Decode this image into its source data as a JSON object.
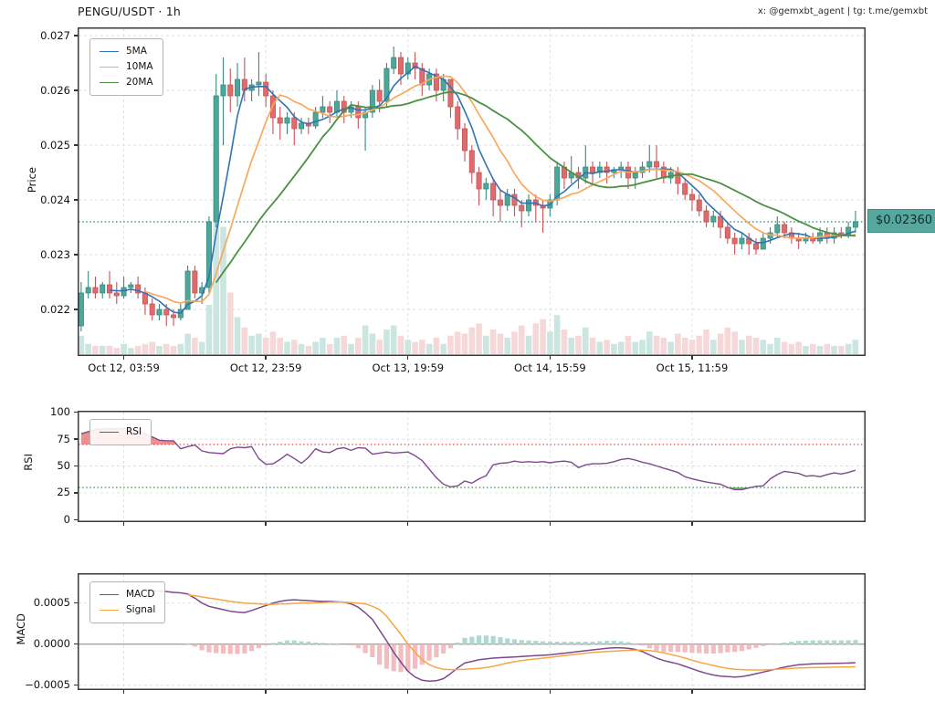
{
  "header": {
    "title": "PENGU/USDT · 1h",
    "watermark": "x: @gemxbt_agent | tg: t.me/gemxbt"
  },
  "price_panel": {
    "ylabel": "Price",
    "y_ticks": [
      "0.027",
      "0.026",
      "0.025",
      "0.024",
      "0.023",
      "0.022"
    ],
    "x_ticks": [
      "Oct 12, 03:59",
      "Oct 12, 23:59",
      "Oct 13, 19:59",
      "Oct 14, 15:59",
      "Oct 15, 11:59"
    ],
    "legend": [
      "5MA",
      "10MA",
      "20MA"
    ],
    "price_tag": "$0.02360"
  },
  "rsi_panel": {
    "ylabel": "RSI",
    "legend": [
      "RSI"
    ],
    "y_ticks": [
      "100",
      "75",
      "50",
      "25",
      "0"
    ],
    "overbought": 70,
    "oversold": 30
  },
  "macd_panel": {
    "ylabel": "MACD",
    "legend": [
      "MACD",
      "Signal"
    ],
    "y_ticks": [
      "0.0005",
      "0.0000",
      "−0.0005"
    ]
  },
  "colors": {
    "up": "#4aa79a",
    "up_border": "#3a8a7e",
    "down": "#e06b6d",
    "down_border": "#c65356",
    "vol_up": "#cbe6e1",
    "vol_down": "#f7d8d9",
    "ma5": "#3173b5",
    "ma10": "#f9a85f",
    "ma20": "#4a9141",
    "rsi": "#7e4a8e",
    "overbought_line": "#ef5a5a",
    "oversold_line": "#43a047",
    "overbought_fill": "rgba(232,74,74,0.62)",
    "oversold_fill": "rgba(67,160,71,0.72)",
    "macd": "#7e4a8e",
    "signal": "#f5a742",
    "hist_up": "#aed9d2",
    "hist_down": "#f3bdc0",
    "price_line": "#43968c",
    "price_tag_bg": "#56a89e",
    "grid": "#dcdcdc",
    "spine": "#3a3a3a"
  },
  "chart_data": {
    "type": "candlestick",
    "title": "PENGU/USDT · 1h",
    "last_price": 0.0236,
    "price_ylim": [
      0.02115,
      0.02715
    ],
    "volume_max": 100,
    "tick_indices": [
      6,
      26,
      46,
      66,
      86
    ],
    "tick_labels": [
      "Oct 12, 03:59",
      "Oct 12, 23:59",
      "Oct 13, 19:59",
      "Oct 14, 15:59",
      "Oct 15, 11:59"
    ],
    "ma_windows": [
      5,
      10,
      20
    ],
    "candles_format": [
      "open",
      "high",
      "low",
      "close",
      "volume"
    ],
    "candles": [
      [
        0.0217,
        0.0225,
        0.0216,
        0.0223,
        9
      ],
      [
        0.0223,
        0.0227,
        0.0222,
        0.0224,
        5
      ],
      [
        0.0224,
        0.0226,
        0.0222,
        0.0223,
        4
      ],
      [
        0.0223,
        0.0225,
        0.0222,
        0.02245,
        4
      ],
      [
        0.02245,
        0.0227,
        0.0222,
        0.0223,
        4
      ],
      [
        0.0223,
        0.0225,
        0.0221,
        0.02225,
        3
      ],
      [
        0.02225,
        0.0226,
        0.0222,
        0.0224,
        5
      ],
      [
        0.0224,
        0.0225,
        0.0223,
        0.02245,
        3
      ],
      [
        0.02245,
        0.0226,
        0.0222,
        0.0223,
        4
      ],
      [
        0.0223,
        0.0224,
        0.0219,
        0.0221,
        5
      ],
      [
        0.0221,
        0.0222,
        0.0218,
        0.0219,
        6
      ],
      [
        0.0219,
        0.0221,
        0.0218,
        0.022,
        4
      ],
      [
        0.022,
        0.0221,
        0.0217,
        0.0219,
        5
      ],
      [
        0.0219,
        0.022,
        0.0217,
        0.02185,
        4
      ],
      [
        0.02185,
        0.0221,
        0.0218,
        0.022,
        5
      ],
      [
        0.022,
        0.0228,
        0.022,
        0.0227,
        10
      ],
      [
        0.0227,
        0.0228,
        0.0222,
        0.0223,
        8
      ],
      [
        0.0223,
        0.0225,
        0.0221,
        0.0224,
        6
      ],
      [
        0.0224,
        0.0237,
        0.0223,
        0.0236,
        24
      ],
      [
        0.0236,
        0.0263,
        0.0235,
        0.0259,
        100
      ],
      [
        0.0259,
        0.0266,
        0.025,
        0.0261,
        62
      ],
      [
        0.0261,
        0.0264,
        0.0256,
        0.0259,
        30
      ],
      [
        0.0259,
        0.0265,
        0.0257,
        0.0262,
        18
      ],
      [
        0.0262,
        0.0266,
        0.0258,
        0.026,
        13
      ],
      [
        0.026,
        0.0262,
        0.0258,
        0.0261,
        9
      ],
      [
        0.0261,
        0.0267,
        0.0259,
        0.02615,
        10
      ],
      [
        0.02615,
        0.0263,
        0.0257,
        0.0259,
        8
      ],
      [
        0.0259,
        0.026,
        0.0252,
        0.0255,
        11
      ],
      [
        0.0255,
        0.0257,
        0.0251,
        0.0254,
        8
      ],
      [
        0.0254,
        0.0256,
        0.0252,
        0.0255,
        6
      ],
      [
        0.0255,
        0.0256,
        0.025,
        0.0253,
        7
      ],
      [
        0.0253,
        0.0255,
        0.0252,
        0.0254,
        5
      ],
      [
        0.0254,
        0.0255,
        0.0252,
        0.02535,
        4
      ],
      [
        0.02535,
        0.0257,
        0.0253,
        0.0256,
        6
      ],
      [
        0.0256,
        0.0259,
        0.0255,
        0.0257,
        8
      ],
      [
        0.0257,
        0.0258,
        0.0254,
        0.0256,
        5
      ],
      [
        0.0256,
        0.026,
        0.0255,
        0.0258,
        8
      ],
      [
        0.0258,
        0.0259,
        0.0254,
        0.0256,
        9
      ],
      [
        0.0256,
        0.0258,
        0.0255,
        0.0257,
        5
      ],
      [
        0.0257,
        0.0258,
        0.0253,
        0.0255,
        8
      ],
      [
        0.0255,
        0.0257,
        0.0249,
        0.0256,
        14
      ],
      [
        0.0256,
        0.0261,
        0.0255,
        0.026,
        10
      ],
      [
        0.026,
        0.0262,
        0.0256,
        0.0258,
        7
      ],
      [
        0.0258,
        0.0265,
        0.0257,
        0.0264,
        12
      ],
      [
        0.0264,
        0.0268,
        0.0263,
        0.0266,
        14
      ],
      [
        0.0266,
        0.0267,
        0.0261,
        0.0263,
        9
      ],
      [
        0.0263,
        0.0266,
        0.0262,
        0.0265,
        7
      ],
      [
        0.0265,
        0.0267,
        0.0262,
        0.0264,
        6
      ],
      [
        0.0264,
        0.0265,
        0.0259,
        0.0261,
        7
      ],
      [
        0.0261,
        0.0264,
        0.026,
        0.0263,
        5
      ],
      [
        0.0263,
        0.0264,
        0.0258,
        0.026,
        8
      ],
      [
        0.026,
        0.0263,
        0.0258,
        0.0262,
        5
      ],
      [
        0.0262,
        0.0262,
        0.0255,
        0.0257,
        9
      ],
      [
        0.0257,
        0.0258,
        0.0251,
        0.0253,
        11
      ],
      [
        0.0253,
        0.0254,
        0.0247,
        0.0249,
        10
      ],
      [
        0.0249,
        0.025,
        0.0243,
        0.0245,
        13
      ],
      [
        0.0245,
        0.0246,
        0.0239,
        0.0242,
        15
      ],
      [
        0.0242,
        0.0244,
        0.024,
        0.0243,
        9
      ],
      [
        0.0243,
        0.0244,
        0.0237,
        0.024,
        12
      ],
      [
        0.024,
        0.0242,
        0.0236,
        0.0239,
        10
      ],
      [
        0.0239,
        0.0242,
        0.0238,
        0.0241,
        8
      ],
      [
        0.0241,
        0.0242,
        0.0237,
        0.0239,
        11
      ],
      [
        0.0239,
        0.024,
        0.0235,
        0.0238,
        14
      ],
      [
        0.0238,
        0.0241,
        0.0237,
        0.024,
        9
      ],
      [
        0.024,
        0.0241,
        0.0236,
        0.0239,
        15
      ],
      [
        0.0239,
        0.024,
        0.0234,
        0.02385,
        17
      ],
      [
        0.02385,
        0.0241,
        0.0237,
        0.024,
        11
      ],
      [
        0.024,
        0.0247,
        0.0239,
        0.0246,
        19
      ],
      [
        0.0246,
        0.0247,
        0.0242,
        0.0244,
        12
      ],
      [
        0.0244,
        0.0248,
        0.0243,
        0.0245,
        8
      ],
      [
        0.0245,
        0.0246,
        0.0242,
        0.0244,
        9
      ],
      [
        0.0244,
        0.025,
        0.0243,
        0.0246,
        13
      ],
      [
        0.0246,
        0.0247,
        0.0243,
        0.0245,
        8
      ],
      [
        0.0245,
        0.0247,
        0.0244,
        0.0246,
        6
      ],
      [
        0.0246,
        0.0247,
        0.0243,
        0.0245,
        7
      ],
      [
        0.0245,
        0.0246,
        0.0244,
        0.02455,
        5
      ],
      [
        0.02455,
        0.0247,
        0.0244,
        0.0246,
        6
      ],
      [
        0.0246,
        0.0247,
        0.0242,
        0.0244,
        9
      ],
      [
        0.0244,
        0.0246,
        0.0242,
        0.0245,
        6
      ],
      [
        0.0245,
        0.0247,
        0.0244,
        0.0246,
        7
      ],
      [
        0.0246,
        0.025,
        0.0245,
        0.0247,
        11
      ],
      [
        0.0247,
        0.025,
        0.0244,
        0.0246,
        9
      ],
      [
        0.0246,
        0.0247,
        0.0243,
        0.0244,
        8
      ],
      [
        0.0244,
        0.0246,
        0.0243,
        0.0245,
        6
      ],
      [
        0.0245,
        0.0246,
        0.0241,
        0.0243,
        10
      ],
      [
        0.0243,
        0.0244,
        0.024,
        0.0241,
        8
      ],
      [
        0.0241,
        0.0242,
        0.0238,
        0.024,
        7
      ],
      [
        0.024,
        0.0241,
        0.0237,
        0.0238,
        9
      ],
      [
        0.0238,
        0.0239,
        0.0235,
        0.0236,
        12
      ],
      [
        0.0236,
        0.0238,
        0.0235,
        0.0237,
        7
      ],
      [
        0.0237,
        0.0238,
        0.0233,
        0.0235,
        10
      ],
      [
        0.0235,
        0.0236,
        0.0232,
        0.0233,
        13
      ],
      [
        0.0233,
        0.0234,
        0.023,
        0.0232,
        11
      ],
      [
        0.0232,
        0.0234,
        0.0231,
        0.0233,
        7
      ],
      [
        0.0233,
        0.0234,
        0.023,
        0.0232,
        9
      ],
      [
        0.0232,
        0.0233,
        0.023,
        0.0231,
        8
      ],
      [
        0.0231,
        0.0234,
        0.0231,
        0.0233,
        7
      ],
      [
        0.0233,
        0.0235,
        0.0232,
        0.0234,
        5
      ],
      [
        0.0234,
        0.0237,
        0.0233,
        0.02355,
        8
      ],
      [
        0.02355,
        0.0236,
        0.0233,
        0.0234,
        6
      ],
      [
        0.0234,
        0.0235,
        0.0232,
        0.0233,
        5
      ],
      [
        0.0233,
        0.0234,
        0.0231,
        0.02325,
        6
      ],
      [
        0.02325,
        0.0234,
        0.0232,
        0.0233,
        4
      ],
      [
        0.0233,
        0.0234,
        0.0232,
        0.02325,
        5
      ],
      [
        0.02325,
        0.0235,
        0.0232,
        0.0234,
        4
      ],
      [
        0.0234,
        0.0235,
        0.0232,
        0.0233,
        5
      ],
      [
        0.0233,
        0.0235,
        0.0232,
        0.0234,
        4
      ],
      [
        0.0234,
        0.0235,
        0.0233,
        0.02335,
        4
      ],
      [
        0.02335,
        0.0236,
        0.0233,
        0.0235,
        5
      ],
      [
        0.0235,
        0.0238,
        0.0234,
        0.0236,
        7
      ]
    ],
    "rsi": {
      "ylim": [
        0,
        100
      ],
      "overbought": 70,
      "oversold": 30,
      "values": [
        80,
        82,
        84,
        84.5,
        85,
        84.5,
        85,
        84.5,
        83,
        80,
        77,
        74,
        73.5,
        73.5,
        66,
        68,
        69.5,
        64,
        62.5,
        62,
        61.5,
        66,
        67.5,
        67,
        68,
        57,
        51.5,
        52,
        56,
        61,
        57,
        52.5,
        58,
        66,
        63,
        62.5,
        66,
        67,
        64.5,
        67,
        66.5,
        61,
        62,
        63,
        62,
        62.5,
        63,
        59.5,
        55,
        47,
        39,
        33,
        30.5,
        31.5,
        36,
        34,
        38,
        41,
        51,
        52.5,
        53,
        54.5,
        53.5,
        54,
        53.5,
        54,
        53,
        54,
        54.5,
        53.5,
        48.5,
        51,
        52,
        52,
        52.5,
        54,
        56,
        57,
        55.5,
        53.5,
        52,
        50,
        48,
        46,
        44,
        40,
        38,
        36.5,
        35,
        34,
        33,
        30,
        28,
        28,
        29.5,
        31,
        31.5,
        38,
        42,
        45,
        44,
        43,
        40.5,
        41,
        40,
        42,
        43.5,
        42.5,
        44,
        46
      ]
    },
    "macd": {
      "ylim": [
        -0.00055,
        0.00075
      ],
      "units": "1e-4",
      "macd": [
        null,
        null,
        null,
        null,
        null,
        null,
        null,
        null,
        null,
        6.6,
        6.5,
        6.45,
        6.4,
        6.3,
        6.25,
        6.1,
        5.6,
        5.0,
        4.6,
        4.4,
        4.2,
        4.0,
        3.9,
        3.85,
        4.1,
        4.4,
        4.7,
        5.0,
        5.2,
        5.35,
        5.4,
        5.35,
        5.3,
        5.25,
        5.2,
        5.2,
        5.15,
        5.1,
        4.9,
        4.5,
        3.8,
        3.0,
        1.7,
        0.4,
        -1.0,
        -2.2,
        -3.3,
        -4.0,
        -4.4,
        -4.5,
        -4.45,
        -4.2,
        -3.6,
        -2.9,
        -2.3,
        -2.1,
        -1.9,
        -1.8,
        -1.7,
        -1.65,
        -1.6,
        -1.55,
        -1.5,
        -1.45,
        -1.4,
        -1.35,
        -1.3,
        -1.2,
        -1.1,
        -1.0,
        -0.9,
        -0.8,
        -0.7,
        -0.6,
        -0.5,
        -0.45,
        -0.45,
        -0.5,
        -0.65,
        -0.9,
        -1.3,
        -1.7,
        -2.0,
        -2.2,
        -2.4,
        -2.7,
        -3.0,
        -3.3,
        -3.55,
        -3.75,
        -3.9,
        -3.95,
        -4.0,
        -3.95,
        -3.8,
        -3.6,
        -3.4,
        -3.2,
        -3.0,
        -2.8,
        -2.65,
        -2.5,
        -2.45,
        -2.4,
        -2.38,
        -2.36,
        -2.34,
        -2.32,
        -2.3,
        -2.25
      ],
      "signal": [
        null,
        null,
        null,
        null,
        null,
        null,
        null,
        null,
        null,
        null,
        null,
        null,
        null,
        null,
        null,
        6.0,
        5.9,
        5.75,
        5.6,
        5.5,
        5.35,
        5.2,
        5.1,
        5.0,
        4.95,
        4.9,
        4.85,
        4.85,
        4.9,
        4.9,
        4.95,
        5.0,
        5.0,
        5.05,
        5.05,
        5.1,
        5.1,
        5.1,
        5.05,
        5.0,
        4.9,
        4.6,
        4.2,
        3.4,
        2.3,
        1.2,
        0.0,
        -1.0,
        -1.9,
        -2.5,
        -2.85,
        -3.05,
        -3.1,
        -3.1,
        -3.05,
        -3.0,
        -2.95,
        -2.85,
        -2.7,
        -2.5,
        -2.3,
        -2.15,
        -2.0,
        -1.9,
        -1.8,
        -1.7,
        -1.6,
        -1.5,
        -1.4,
        -1.3,
        -1.2,
        -1.1,
        -1.0,
        -0.95,
        -0.9,
        -0.85,
        -0.8,
        -0.75,
        -0.72,
        -0.72,
        -0.78,
        -0.9,
        -1.05,
        -1.25,
        -1.45,
        -1.7,
        -1.95,
        -2.2,
        -2.4,
        -2.6,
        -2.8,
        -2.95,
        -3.05,
        -3.1,
        -3.15,
        -3.15,
        -3.15,
        -3.1,
        -3.05,
        -3.0,
        -2.95,
        -2.9,
        -2.88,
        -2.86,
        -2.84,
        -2.82,
        -2.8,
        -2.79,
        -2.78,
        -2.76
      ],
      "histogram_rule": "macd_minus_signal"
    }
  }
}
